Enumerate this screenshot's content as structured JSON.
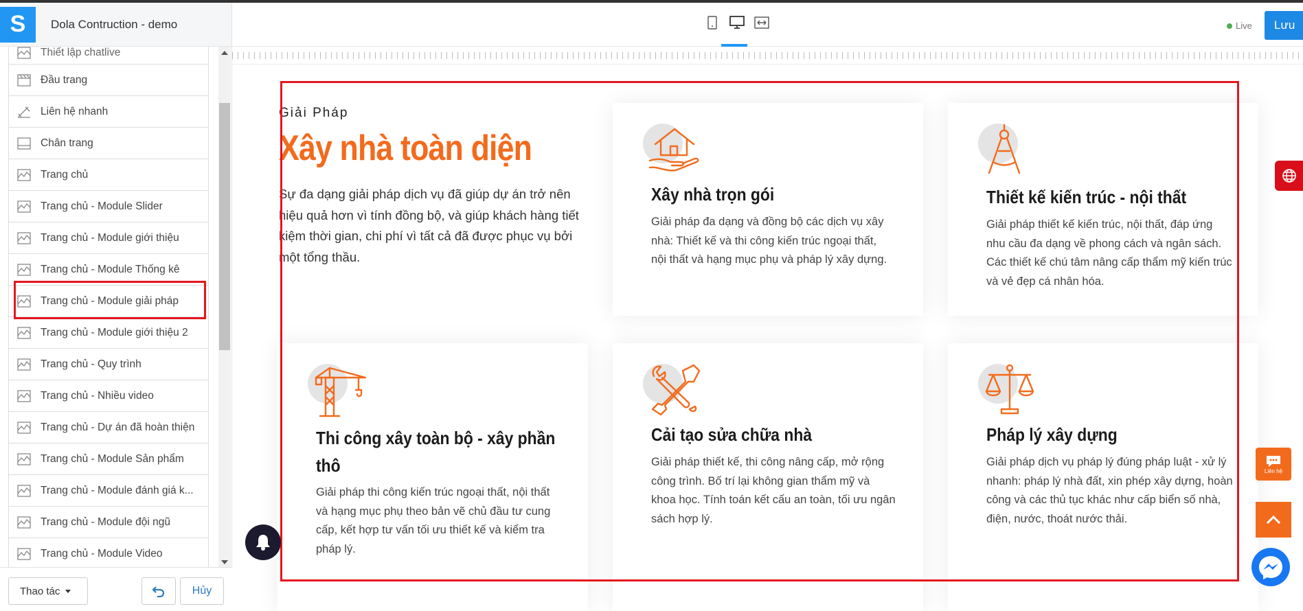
{
  "app": {
    "site_title": "Dola Contruction - demo",
    "logo_letter": "S"
  },
  "sidebar": {
    "items": [
      {
        "label": "Thiết lập chatlive"
      },
      {
        "label": "Đầu trang"
      },
      {
        "label": "Liên hệ nhanh"
      },
      {
        "label": "Chân trang"
      },
      {
        "label": "Trang chủ"
      },
      {
        "label": "Trang chủ - Module Slider"
      },
      {
        "label": "Trang chủ - Module giới thiệu"
      },
      {
        "label": "Trang chủ - Module Thống kê"
      },
      {
        "label": "Trang chủ - Module giải pháp"
      },
      {
        "label": "Trang chủ - Module giới thiệu 2"
      },
      {
        "label": "Trang chủ - Quy trình"
      },
      {
        "label": "Trang chủ - Nhiều video"
      },
      {
        "label": "Trang chủ - Dự án đã hoàn thiện"
      },
      {
        "label": "Trang chủ - Module Sản phẩm"
      },
      {
        "label": "Trang chủ - Module đánh giá k..."
      },
      {
        "label": "Trang chủ - Module đội ngũ"
      },
      {
        "label": "Trang chủ - Module Video"
      }
    ],
    "selected_index": 8
  },
  "footer": {
    "actions_label": "Thao tác",
    "cancel_label": "Hủy"
  },
  "topbar": {
    "live_label": "Live",
    "save_label": "Lưu",
    "active_device": "desktop"
  },
  "section": {
    "kicker": "Giải Pháp",
    "heading": "Xây nhà toàn diện",
    "text": "Sự đa dạng giải pháp dịch vụ đã giúp dự án trở nên hiệu quả hơn vì tính đồng bộ, và giúp khách hàng tiết kiệm thời gian, chi phí vì tất cả đã được phục vụ bởi một tổng thầu.",
    "cards": [
      {
        "icon": "house-hand-icon",
        "title": "Xây nhà trọn gói",
        "desc": "Giải pháp đa dạng và đồng bộ các dịch vụ xây nhà: Thiết kế và thi công kiến trúc ngoại thất, nội thất và hạng mục phụ và pháp lý xây dựng."
      },
      {
        "icon": "compass-icon",
        "title": "Thiết kế kiến trúc - nội thất",
        "desc": "Giải pháp thiết kế kiến trúc, nội thất, đáp ứng nhu cầu đa dạng về phong cách và ngân sách. Các thiết kế chú tâm nâng cấp thẩm mỹ kiến trúc và vẻ đẹp cá nhân hóa."
      },
      {
        "icon": "crane-icon",
        "title": "Thi công xây toàn bộ - xây phần thô",
        "desc": "Giải pháp thi công kiến trúc ngoại thất, nội thất và hạng mục phụ theo bản vẽ chủ đầu tư cung cấp, kết hợp tư vấn tối ưu thiết kế và kiểm tra pháp lý."
      },
      {
        "icon": "tools-icon",
        "title": "Cải tạo sửa chữa nhà",
        "desc": "Giải pháp thiết kế, thi công nâng cấp, mở rộng công trình. Bố trí lại không gian thẩm mỹ và khoa học. Tính toán kết cấu an toàn, tối ưu ngân sách hợp lý."
      },
      {
        "icon": "scales-icon",
        "title": "Pháp lý xây dựng",
        "desc": "Giải pháp dịch vụ pháp lý đúng pháp luật - xử lý nhanh: pháp lý nhà đất, xin phép xây dựng, hoàn công và các thủ tục khác như cấp biển số nhà, điện, nước, thoát nước thải."
      }
    ]
  },
  "floating": {
    "contact_label": "Liên hệ"
  },
  "colors": {
    "accent": "#f26b1d",
    "primary": "#1e88e5",
    "highlight": "#e4161f"
  }
}
